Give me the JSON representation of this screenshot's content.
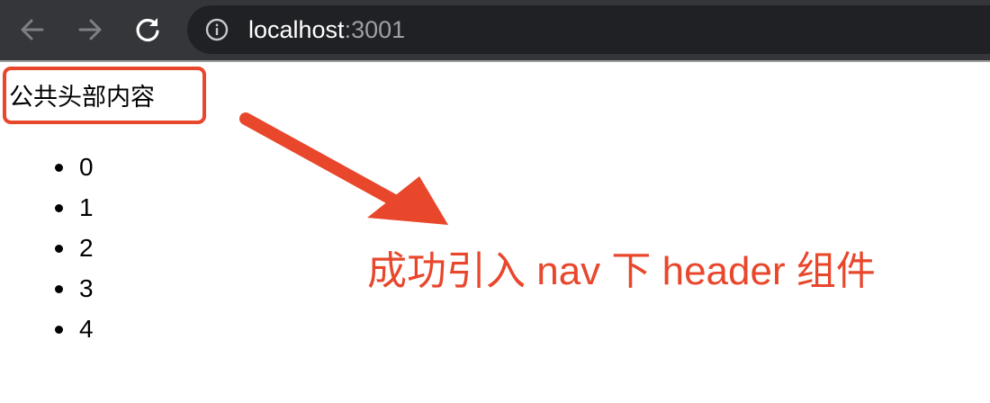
{
  "browser": {
    "url_host": "localhost",
    "url_port": ":3001",
    "back_icon": "arrow-left-icon",
    "forward_icon": "arrow-right-icon",
    "reload_icon": "reload-icon",
    "site_info_icon": "info-icon"
  },
  "page": {
    "header_text": "公共头部内容",
    "list_items": [
      "0",
      "1",
      "2",
      "3",
      "4"
    ]
  },
  "annotation": {
    "text": "成功引入 nav 下 header 组件",
    "color": "#e8472c"
  }
}
